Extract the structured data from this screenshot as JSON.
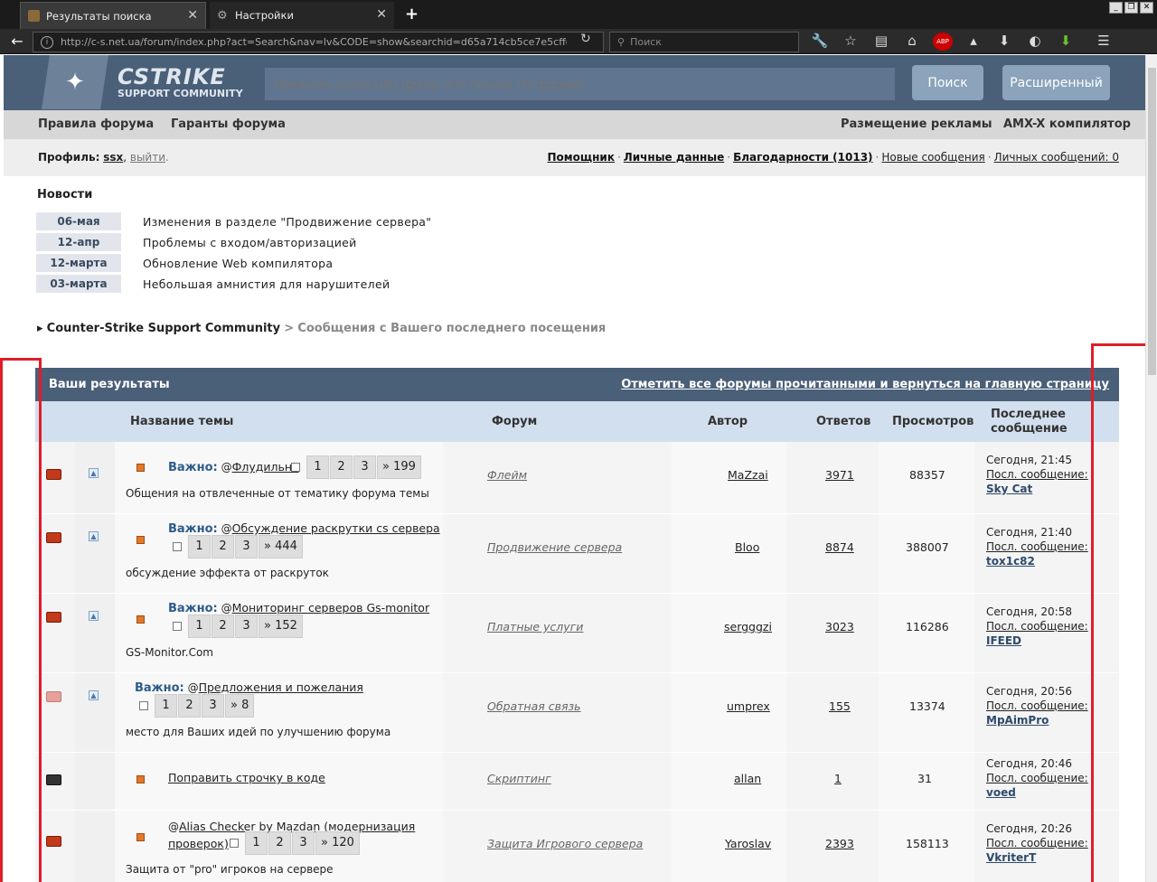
{
  "browser": {
    "tabs": [
      {
        "label": "Результаты поиска",
        "active": true
      },
      {
        "label": "Настройки",
        "active": false
      }
    ],
    "url": "http://c-s.net.ua/forum/index.php?act=Search&nav=lv&CODE=show&searchid=d65a714cb5ce7e5cffd8a384cf6",
    "search_placeholder": "Поиск",
    "adblock_label": "ABP"
  },
  "site": {
    "brand": "CSTRIKE",
    "sub": "SUPPORT COMMUNITY",
    "search_placeholder": "Введите слово или фразу для поиска по форуму",
    "search_button": "Поиск",
    "advanced_button": "Расширенный",
    "nav": {
      "left": [
        "Правила форума",
        "Гаранты форума"
      ],
      "right": [
        "Размещение рекламы",
        "AMX-X компилятор"
      ]
    },
    "profile": {
      "label": "Профиль:",
      "user": "ssx",
      "logout": "выйти",
      "links": [
        "Помощник",
        "Личные данные",
        "Благодарности (1013)",
        "Новые сообщения",
        "Личных сообщений: 0"
      ]
    },
    "news": {
      "title": "Новости",
      "items": [
        {
          "date": "06-мая",
          "text": "Изменения в разделе \"Продвижение сервера\""
        },
        {
          "date": "12-апр",
          "text": "Проблемы с входом/авторизацией"
        },
        {
          "date": "12-марта",
          "text": "Обновление Web компилятора"
        },
        {
          "date": "03-марта",
          "text": "Небольшая амнистия для нарушителей"
        }
      ]
    },
    "breadcrumb": {
      "marker": "▸",
      "home": "Counter-Strike Support Community",
      "sep": ">",
      "current": "Сообщения с Вашего последнего посещения"
    },
    "results": {
      "title": "Ваши результаты",
      "mark_read": "Отметить все форумы прочитанными и вернуться на главную страницу",
      "columns": [
        "Название темы",
        "Форум",
        "Автор",
        "Ответов",
        "Просмотров",
        "Последнее сообщение"
      ],
      "important_label": "Важно:",
      "last_label": "Посл. сообщение:",
      "rows": [
        {
          "title": "Флудильня",
          "pages": [
            "1",
            "2",
            "3",
            "» 199"
          ],
          "desc": "Общения на отвлеченные от тематику форума темы",
          "forum": "Флейм",
          "author": "MaZzai",
          "replies": "3971",
          "views": "88357",
          "last_time": "Сегодня, 21:45",
          "last_user": "Sky Cat"
        },
        {
          "title": "Обсуждение раскрутки cs сервера",
          "pages": [
            "1",
            "2",
            "3",
            "» 444"
          ],
          "desc": "обсуждение эффекта от раскруток",
          "forum": "Продвижение сервера",
          "author": "Bloo",
          "replies": "8874",
          "views": "388007",
          "last_time": "Сегодня, 21:40",
          "last_user": "tox1c82"
        },
        {
          "title": "Мониторинг серверов Gs-monitor",
          "pages": [
            "1",
            "2",
            "3",
            "» 152"
          ],
          "desc": "GS-Monitor.Com",
          "forum": "Платные услуги",
          "author": "sergggzi",
          "replies": "3023",
          "views": "116286",
          "last_time": "Сегодня, 20:58",
          "last_user": "IFEED"
        },
        {
          "title": "Предложения и пожелания",
          "pages": [
            "1",
            "2",
            "3",
            "» 8"
          ],
          "desc": "место для Ваших идей по улучшению форума",
          "forum": "Обратная связь",
          "author": "umprex",
          "replies": "155",
          "views": "13374",
          "last_time": "Сегодня, 20:56",
          "last_user": "MpAimPro"
        },
        {
          "title": "Поправить строчку в коде",
          "forum": "Скриптинг",
          "author": "allan",
          "replies": "1",
          "views": "31",
          "last_time": "Сегодня, 20:46",
          "last_user": "voed"
        },
        {
          "title_1": "Alias Checker by Mazdan (модернизация",
          "title_2": "проверок)",
          "pages": [
            "1",
            "2",
            "3",
            "» 120"
          ],
          "desc": "Защита от \"pro\" игроков на сервере",
          "forum": "Защита Игрового сервера",
          "author": "Yaroslav",
          "replies": "2393",
          "views": "158113",
          "last_time": "Сегодня, 20:26",
          "last_user": "VkriterT"
        }
      ]
    }
  },
  "colors": {
    "accent": "#4a5f78",
    "highlight": "#e01e28"
  }
}
